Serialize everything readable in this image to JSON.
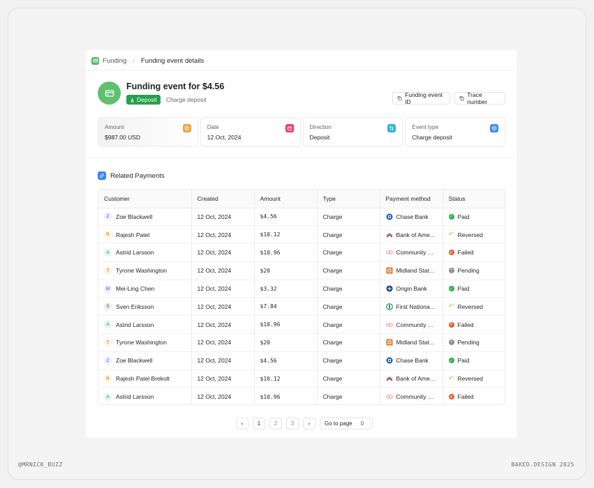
{
  "breadcrumb": {
    "parent": "Funding",
    "separator": "/",
    "current": "Funding event details"
  },
  "event": {
    "title": "Funding event for $4.56",
    "badge": "Deposit",
    "subtitle": "Charge deposit"
  },
  "actions": {
    "funding_event_id": "Funding event ID",
    "trace_number": "Trace number"
  },
  "stats": [
    {
      "label": "Amount",
      "value": "$987.00 USD",
      "icon": "dollar-icon",
      "color": "#f2a33a"
    },
    {
      "label": "Date",
      "value": "12 Oct, 2024",
      "icon": "calendar-icon",
      "color": "#ec3a6a"
    },
    {
      "label": "Direction",
      "value": "Deposit",
      "icon": "arrows-icon",
      "color": "#2eb6d6"
    },
    {
      "label": "Event type",
      "value": "Charge deposit",
      "icon": "cube-icon",
      "color": "#3b8bf6"
    }
  ],
  "related": {
    "title": "Related Payments"
  },
  "table": {
    "columns": [
      "Customer",
      "Created",
      "Amount",
      "Type",
      "Payment method",
      "Status"
    ],
    "rows": [
      {
        "initial": "Z",
        "customer": "Zoe Blackwell",
        "created": "12 Oct, 2024",
        "amount": "$4.56",
        "type": "Charge",
        "bank": "Chase Bank",
        "status": "Paid"
      },
      {
        "initial": "R",
        "customer": "Rajesh Patel",
        "created": "12 Oct, 2024",
        "amount": "$10.12",
        "type": "Charge",
        "bank": "Bank of America",
        "status": "Reversed"
      },
      {
        "initial": "A",
        "customer": "Astrid Larsson",
        "created": "12 Oct, 2024",
        "amount": "$10.96",
        "type": "Charge",
        "bank": "Community Bank",
        "status": "Failed"
      },
      {
        "initial": "T",
        "customer": "Tyrone Washington",
        "created": "12 Oct, 2024",
        "amount": "$20",
        "type": "Charge",
        "bank": "Midland States Bank",
        "status": "Pending"
      },
      {
        "initial": "M",
        "customer": "Mei-Ling Chen",
        "created": "12 Oct, 2024",
        "amount": "$3.32",
        "type": "Charge",
        "bank": "Origin Bank",
        "status": "Paid"
      },
      {
        "initial": "S",
        "customer": "Sven Eriksson",
        "created": "12 Oct, 2024",
        "amount": "$7.84",
        "type": "Charge",
        "bank": "First National Bank",
        "status": "Reversed"
      },
      {
        "initial": "A",
        "customer": "Astrid Larsson",
        "created": "12 Oct, 2024",
        "amount": "$10.96",
        "type": "Charge",
        "bank": "Community Bank",
        "status": "Failed"
      },
      {
        "initial": "T",
        "customer": "Tyrone Washington",
        "created": "12 Oct, 2024",
        "amount": "$20",
        "type": "Charge",
        "bank": "Midland States Bank",
        "status": "Pending"
      },
      {
        "initial": "Z",
        "customer": "Zoe Blackwell",
        "created": "12 Oct, 2024",
        "amount": "$4.56",
        "type": "Charge",
        "bank": "Chase Bank",
        "status": "Paid"
      },
      {
        "initial": "R",
        "customer": "Rajesh Patel Brekolt",
        "created": "12 Oct, 2024",
        "amount": "$10.12",
        "type": "Charge",
        "bank": "Bank of America",
        "status": "Reversed"
      },
      {
        "initial": "A",
        "customer": "Astrid Larsson",
        "created": "12 Oct, 2024",
        "amount": "$10.96",
        "type": "Charge",
        "bank": "Community Bank",
        "status": "Failed"
      }
    ]
  },
  "pagination": {
    "prev": "‹",
    "pages": [
      "1",
      "2",
      "3"
    ],
    "next": "›",
    "goto_label": "Go to page",
    "goto_value": "0"
  },
  "footer": {
    "left": "@MRNICK_BUZZ",
    "right": "BAKED.DESIGN 2025"
  },
  "colors": {
    "initial": {
      "Z": [
        "#e8efff",
        "#3b64c9"
      ],
      "R": [
        "#fff5dc",
        "#a37a10"
      ],
      "A": [
        "#e6f6ea",
        "#2c8a45"
      ],
      "T": [
        "#fff0e0",
        "#b8661a"
      ],
      "M": [
        "#f0eaff",
        "#6a44c9"
      ],
      "S": [
        "#eeeeee",
        "#555555"
      ]
    },
    "status": {
      "Paid": "#2fae55",
      "Reversed": "#f2a33a",
      "Failed": "#ef5a2a",
      "Pending": "#8a8f98"
    }
  }
}
